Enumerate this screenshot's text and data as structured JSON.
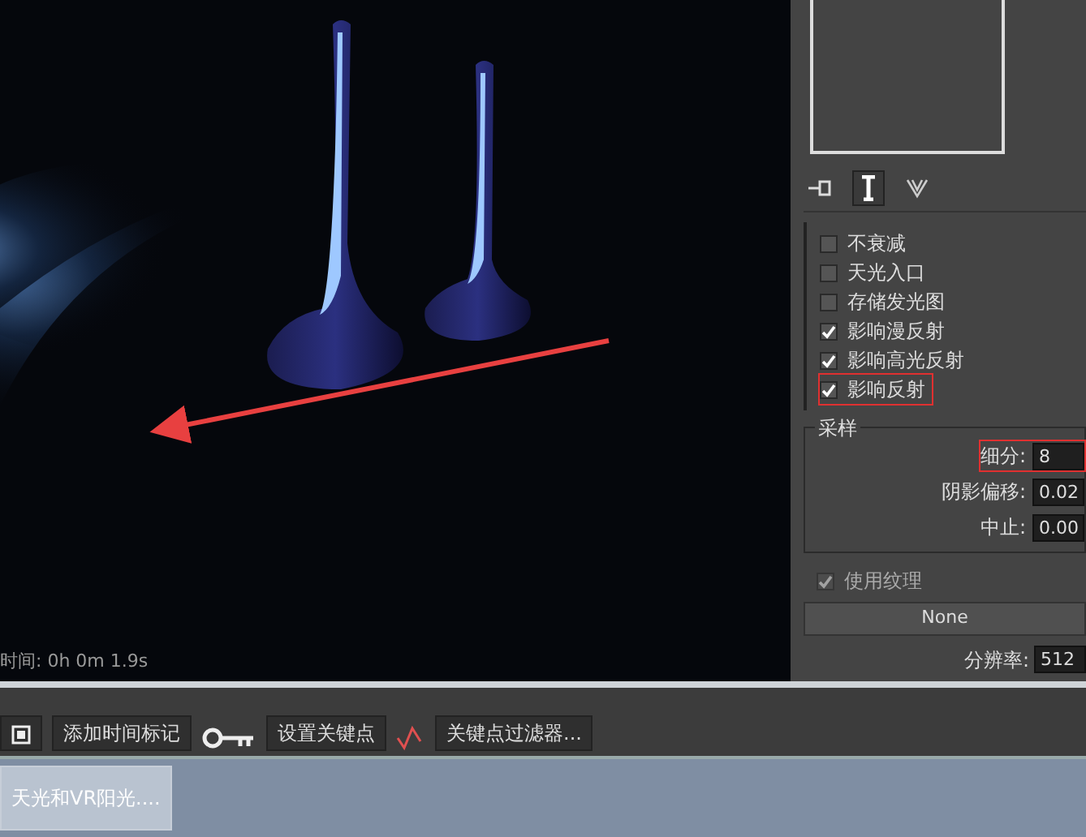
{
  "render": {
    "time_label": "时间: 0h 0m 1.9s"
  },
  "light_options": [
    {
      "label": "不衰减",
      "checked": false,
      "highlighted": false
    },
    {
      "label": "天光入口",
      "checked": false,
      "highlighted": false
    },
    {
      "label": "存储发光图",
      "checked": false,
      "highlighted": false
    },
    {
      "label": "影响漫反射",
      "checked": true,
      "highlighted": false
    },
    {
      "label": "影响高光反射",
      "checked": true,
      "highlighted": false
    },
    {
      "label": "影响反射",
      "checked": true,
      "highlighted": true
    }
  ],
  "sampling": {
    "title": "采样",
    "fields": [
      {
        "label": "细分:",
        "value": "8",
        "highlighted": true
      },
      {
        "label": "阴影偏移:",
        "value": "0.02",
        "highlighted": false
      },
      {
        "label": "中止:",
        "value": "0.00",
        "highlighted": false
      }
    ]
  },
  "texture": {
    "label": "使用纹理",
    "checked": true,
    "disabled": true,
    "map_button": "None",
    "resolution_label": "分辨率:",
    "resolution_value": "512"
  },
  "timeline": {
    "add_time_tag": "添加时间标记",
    "set_key": "设置关键点",
    "key_filters": "关键点过滤器..."
  },
  "taskbar": [
    {
      "label": "天光和VR阳光....",
      "selected": true
    }
  ]
}
